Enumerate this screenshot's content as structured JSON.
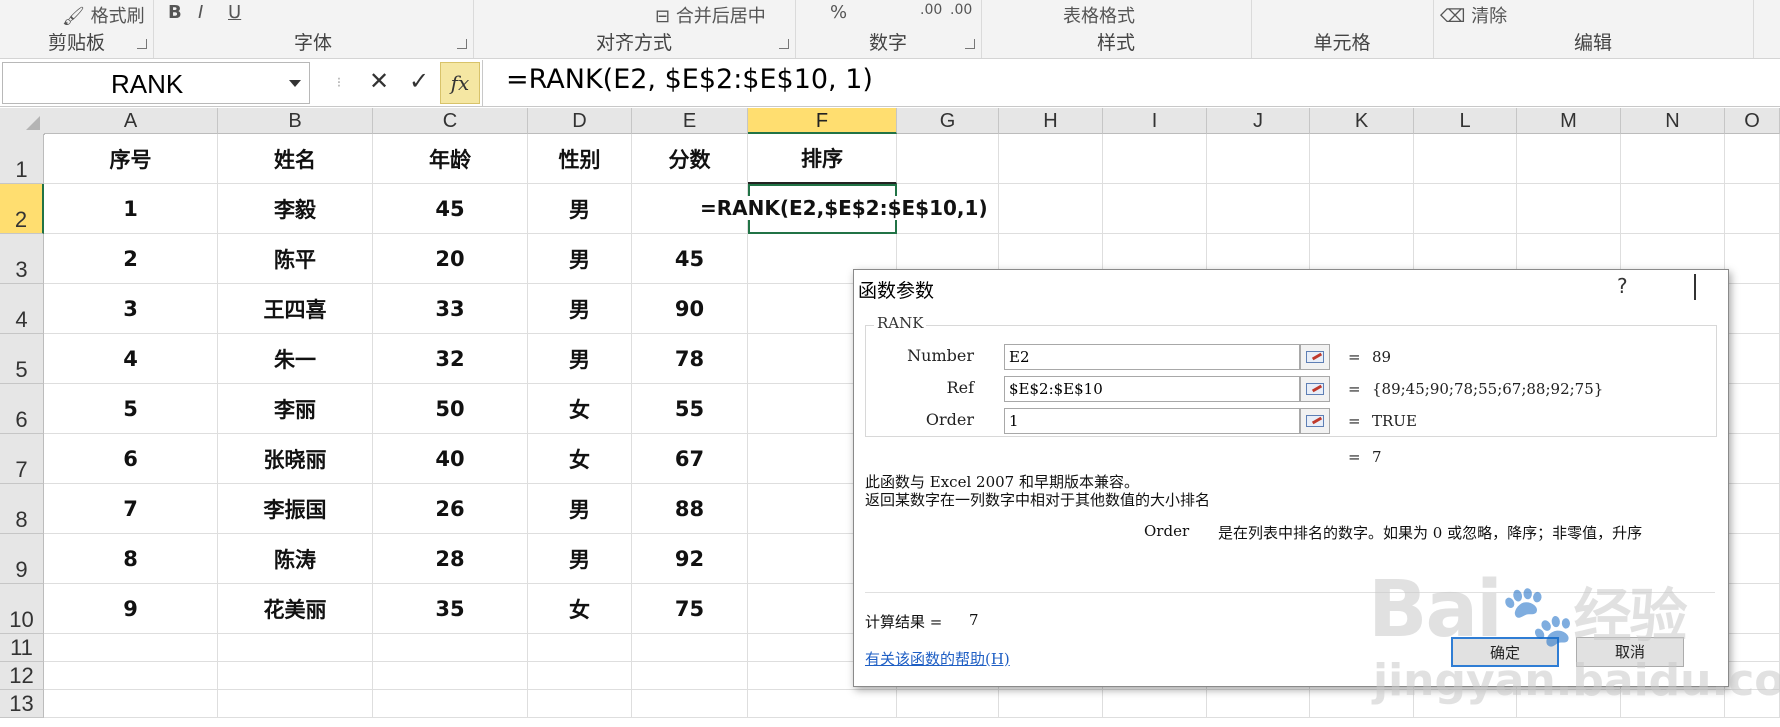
{
  "ribbon": {
    "groups": [
      "剪贴板",
      "字体",
      "对齐方式",
      "数字",
      "样式",
      "单元格",
      "编辑"
    ],
    "format_painter": "格式刷",
    "merge_center": "合并后居中",
    "table_format": "表格格式",
    "clear": "清除",
    "percent": "%",
    "dec_inc": ".00",
    "dec_dec": ".00"
  },
  "formula_bar": {
    "name_box": "RANK",
    "fx": "fx",
    "formula": "=RANK(E2, $E$2:$E$10, 1)"
  },
  "columns": [
    "A",
    "B",
    "C",
    "D",
    "E",
    "F",
    "G",
    "H",
    "I",
    "J",
    "K",
    "L",
    "M",
    "N",
    "O"
  ],
  "selected_column": "F",
  "rows": [
    "1",
    "2",
    "3",
    "4",
    "5",
    "6",
    "7",
    "8",
    "9",
    "10",
    "11",
    "12",
    "13"
  ],
  "selected_row": "2",
  "headers": [
    "序号",
    "姓名",
    "年龄",
    "性别",
    "分数",
    "排序"
  ],
  "table": [
    [
      "1",
      "李毅",
      "45",
      "男",
      ""
    ],
    [
      "2",
      "陈平",
      "20",
      "男",
      "45"
    ],
    [
      "3",
      "王四喜",
      "33",
      "男",
      "90"
    ],
    [
      "4",
      "朱一",
      "32",
      "男",
      "78"
    ],
    [
      "5",
      "李丽",
      "50",
      "女",
      "55"
    ],
    [
      "6",
      "张晓丽",
      "40",
      "女",
      "67"
    ],
    [
      "7",
      "李振国",
      "26",
      "男",
      "88"
    ],
    [
      "8",
      "陈涛",
      "28",
      "男",
      "92"
    ],
    [
      "9",
      "花美丽",
      "35",
      "女",
      "75"
    ]
  ],
  "active_cell_formula": "=RANK(E2,$E$2:$E$10,1)",
  "dialog": {
    "title": "函数参数",
    "help_icon": "?",
    "function_name": "RANK",
    "args": [
      {
        "label": "Number",
        "value": "E2",
        "result": "89"
      },
      {
        "label": "Ref",
        "value": "$E$2:$E$10",
        "result": "{89;45;90;78;55;67;88;92;75}"
      },
      {
        "label": "Order",
        "value": "1",
        "result": "TRUE"
      }
    ],
    "equals": "=",
    "overall_result": "7",
    "compat_text": "此函数与 Excel 2007 和早期版本兼容。",
    "description": "返回某数字在一列数字中相对于其他数值的大小排名",
    "arg_name": "Order",
    "arg_desc": "是在列表中排名的数字。如果为 0 或忽略，降序；非零值，升序",
    "calc_result_label": "计算结果 =",
    "calc_result_value": "7",
    "help_link": "有关该函数的帮助(H)",
    "ok": "确定",
    "cancel": "取消"
  },
  "watermark": {
    "brand": "Bai",
    "brand_cn": "经验",
    "url": "jingyan.baidu.com"
  }
}
